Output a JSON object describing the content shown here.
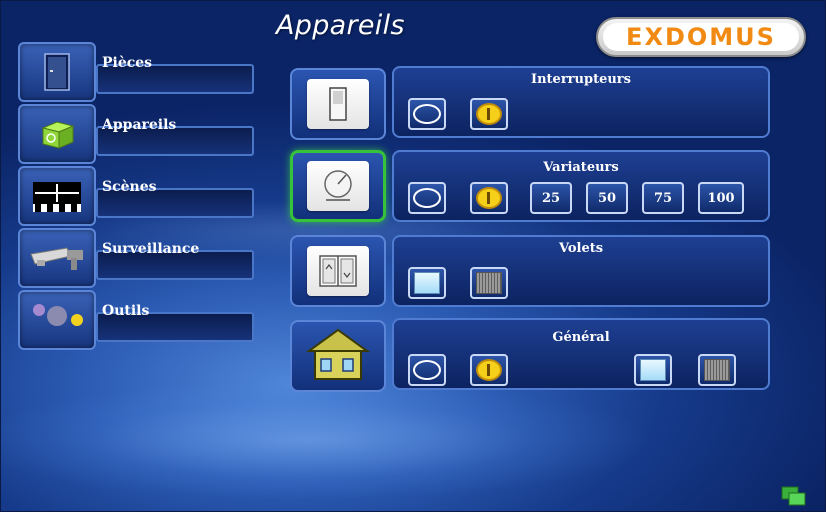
{
  "header": {
    "title": "Appareils",
    "logo_text": "EXDOMUS"
  },
  "sidebar": {
    "items": [
      {
        "label": "Pièces",
        "icon": "door-icon"
      },
      {
        "label": "Appareils",
        "icon": "device-cube-icon"
      },
      {
        "label": "Scènes",
        "icon": "clapperboard-icon"
      },
      {
        "label": "Surveillance",
        "icon": "camera-icon"
      },
      {
        "label": "Outils",
        "icon": "gears-icon"
      }
    ]
  },
  "devices": {
    "interrupteurs": {
      "title": "Interrupteurs"
    },
    "variateurs": {
      "title": "Variateurs",
      "levels": [
        "25",
        "50",
        "75",
        "100"
      ]
    },
    "volets": {
      "title": "Volets"
    },
    "general": {
      "title": "Général"
    }
  },
  "colors": {
    "accent_green": "#37c23c",
    "logo_orange": "#f08a12",
    "on_yellow": "#f5cf1a"
  }
}
